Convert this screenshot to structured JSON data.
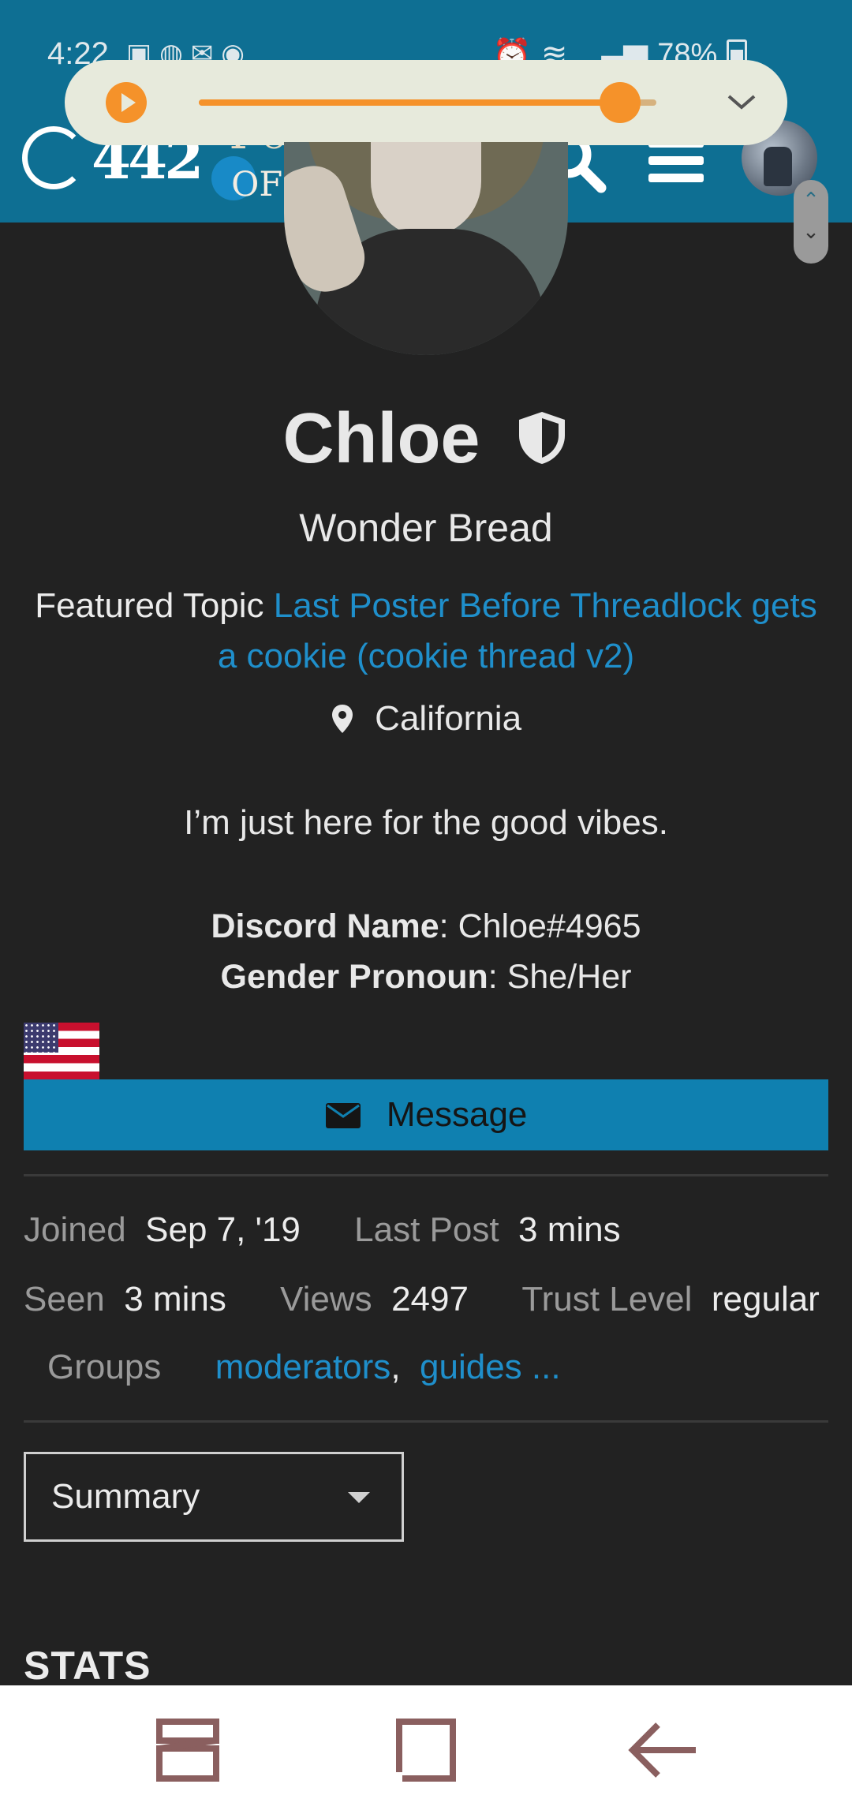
{
  "status_bar": {
    "time": "4:22",
    "battery": "78%"
  },
  "media_player": {
    "progress": 0.92
  },
  "header": {
    "site_logo_text": "442",
    "forum_logo_line1": "Forum",
    "forum_logo_line2": "of Lies"
  },
  "profile": {
    "name": "Chloe",
    "title": "Wonder Bread",
    "featured_label": "Featured Topic",
    "featured_topic": "Last Poster Before Threadlock gets a cookie (cookie thread v2)",
    "location": "California",
    "bio": "I’m just here for the good vibes.",
    "fields": [
      {
        "label": "Discord Name",
        "value": "Chloe#4965"
      },
      {
        "label": "Gender Pronoun",
        "value": "She/Her"
      }
    ],
    "message_button": "Message"
  },
  "stats": {
    "joined_label": "Joined",
    "joined_value": "Sep 7, '19",
    "last_post_label": "Last Post",
    "last_post_value": "3 mins",
    "seen_label": "Seen",
    "seen_value": "3 mins",
    "views_label": "Views",
    "views_value": "2497",
    "trust_label": "Trust Level",
    "trust_value": "regular",
    "groups_label": "Groups",
    "group_1": "moderators",
    "group_separator": ",",
    "group_2": "guides ..."
  },
  "summary_select": {
    "value": "Summary"
  },
  "stats_heading": "STATS",
  "colors": {
    "header_bg": "#0e6f93",
    "page_bg": "#222222",
    "link": "#1f8fcb",
    "button": "#0f80b0",
    "media_accent": "#f5922a"
  },
  "icons": {
    "discord": "discord-icon",
    "search": "search-icon",
    "menu": "hamburger-icon",
    "location": "map-pin-icon",
    "moderator": "shield-icon",
    "message": "envelope-icon"
  }
}
